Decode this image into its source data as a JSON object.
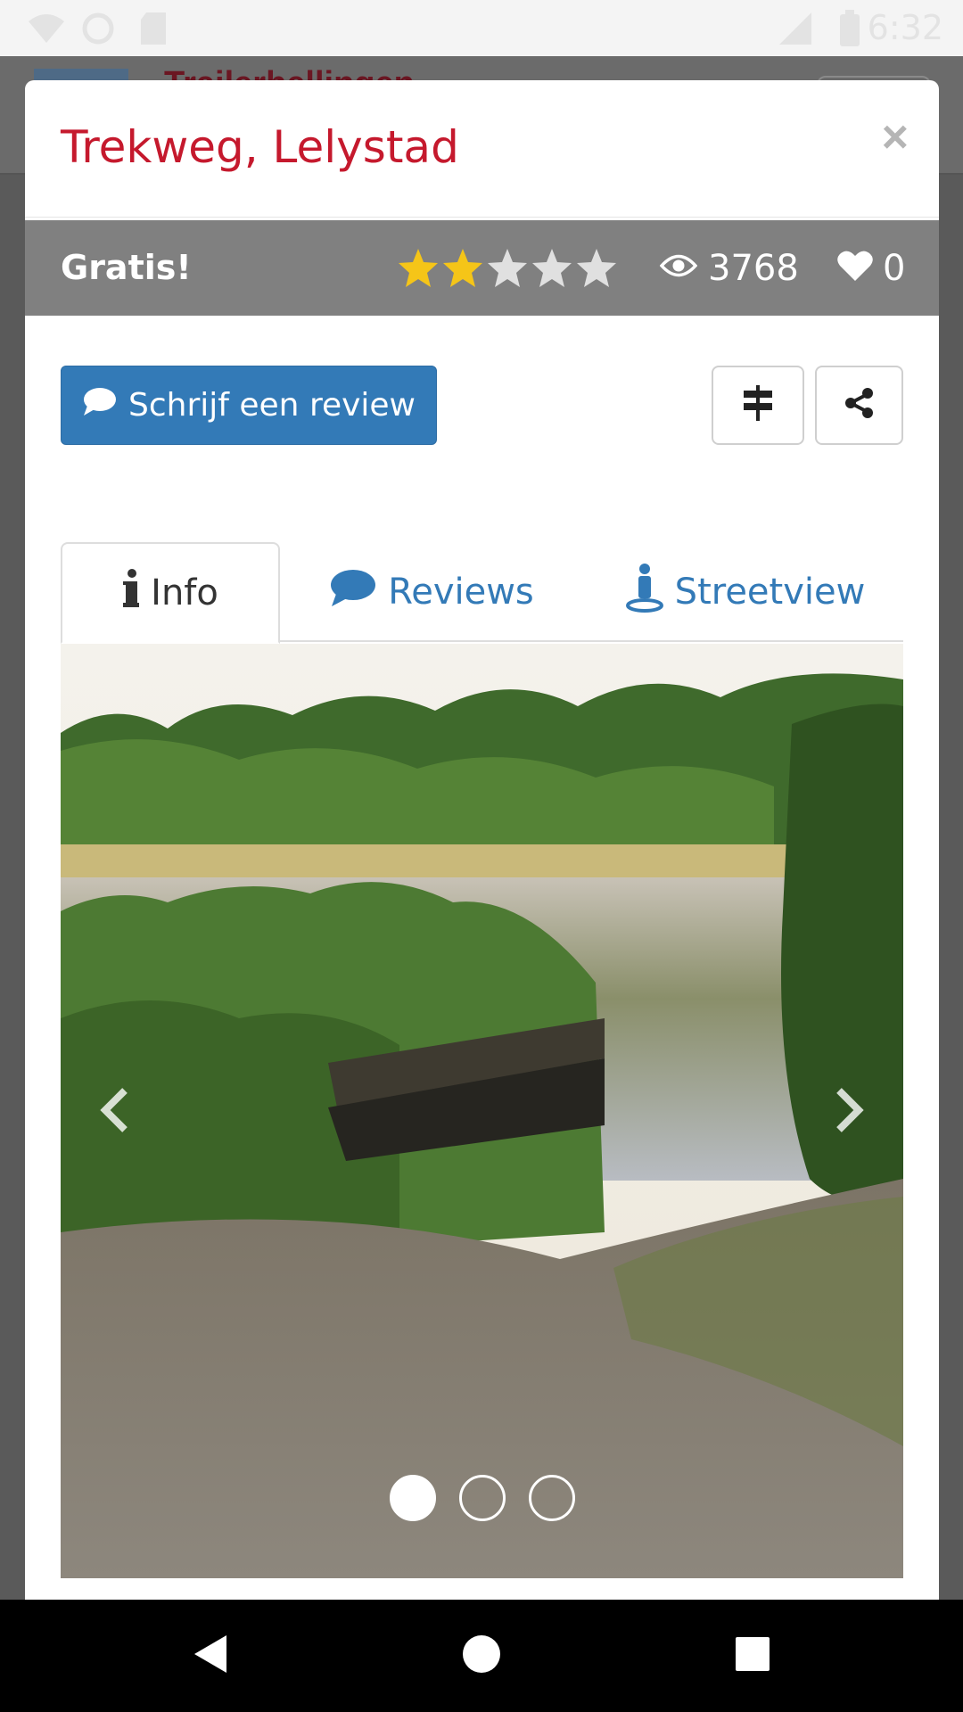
{
  "status_bar": {
    "time": "6:32"
  },
  "background_app": {
    "title": "Trailerhellingen"
  },
  "modal": {
    "title": "Trekweg, Lelystad",
    "close_symbol": "×",
    "info_bar": {
      "price_label": "Gratis!",
      "rating": 2,
      "rating_max": 5,
      "views": "3768",
      "likes": "0",
      "star_color_filled": "#f5c518",
      "star_color_empty": "#e0e0e0"
    },
    "review_button": {
      "icon": "comment-icon",
      "label": "Schrijf een review"
    },
    "directions_button": {
      "icon": "signpost-icon"
    },
    "share_button": {
      "icon": "share-icon"
    },
    "tabs": [
      {
        "icon": "info-icon",
        "label": "Info",
        "active": true
      },
      {
        "icon": "comment-icon",
        "label": "Reviews",
        "active": false
      },
      {
        "icon": "street-view-icon",
        "label": "Streetview",
        "active": false
      }
    ],
    "carousel": {
      "slide_count": 3,
      "active_slide": 1,
      "image_description": "boat ramp by a lake with reeds and trees"
    }
  },
  "colors": {
    "title_red": "#c5192d",
    "primary_blue": "#337ab7",
    "info_bar_gray": "#808080"
  }
}
